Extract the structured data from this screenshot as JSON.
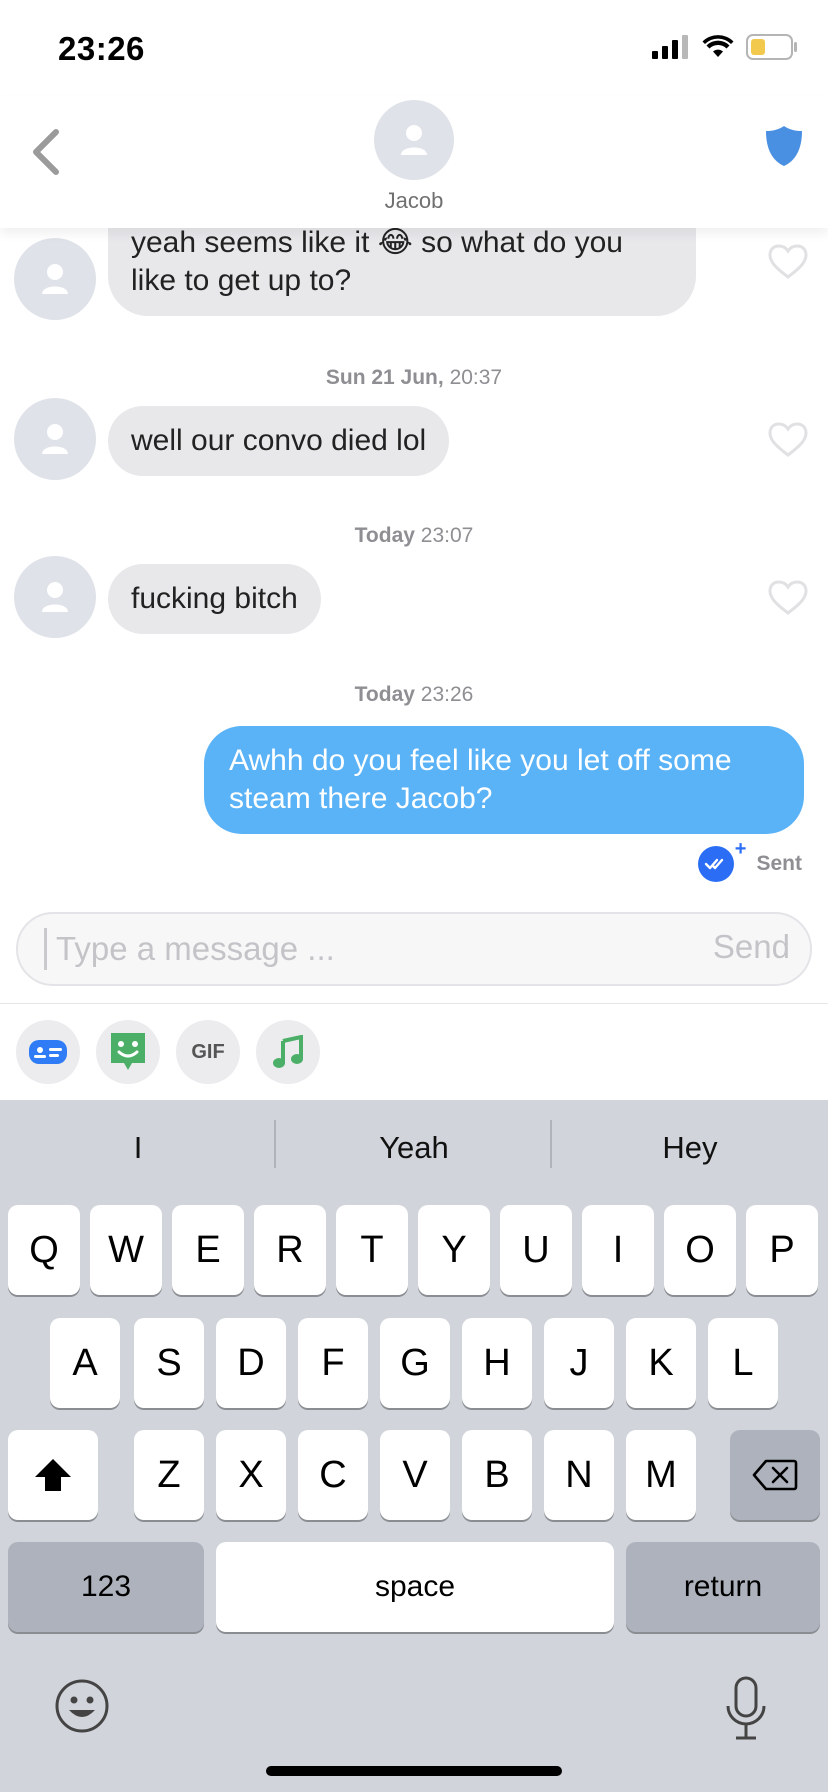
{
  "status_bar": {
    "time": "23:26"
  },
  "header": {
    "contact_name": "Jacob"
  },
  "messages": [
    {
      "text_line1": "yeah seems like it 😂 so what do you",
      "text_line2": "like to get up to?"
    },
    {
      "timestamp_day": "Sun 21 Jun,",
      "timestamp_time": "20:37",
      "text": "well our convo died lol"
    },
    {
      "timestamp_day": "Today",
      "timestamp_time": "23:07",
      "text": "fucking bitch"
    },
    {
      "timestamp_day": "Today",
      "timestamp_time": "23:26",
      "text_line1": "Awhh do you feel like you let off some",
      "text_line2": "steam there Jacob?",
      "status": "Sent"
    }
  ],
  "composer": {
    "placeholder": "Type a message ...",
    "send_label": "Send"
  },
  "tools": {
    "gif_label": "GIF"
  },
  "keyboard": {
    "suggestions": [
      "I",
      "Yeah",
      "Hey"
    ],
    "row1": [
      "Q",
      "W",
      "E",
      "R",
      "T",
      "Y",
      "U",
      "I",
      "O",
      "P"
    ],
    "row2": [
      "A",
      "S",
      "D",
      "F",
      "G",
      "H",
      "J",
      "K",
      "L"
    ],
    "row3": [
      "Z",
      "X",
      "C",
      "V",
      "B",
      "N",
      "M"
    ],
    "numbers_label": "123",
    "space_label": "space",
    "return_label": "return"
  },
  "colors": {
    "outgoing_bubble": "#5ab2f7",
    "incoming_bubble": "#e8e8eb",
    "accent": "#2b6ef5",
    "keyboard_bg": "#d1d4da"
  }
}
